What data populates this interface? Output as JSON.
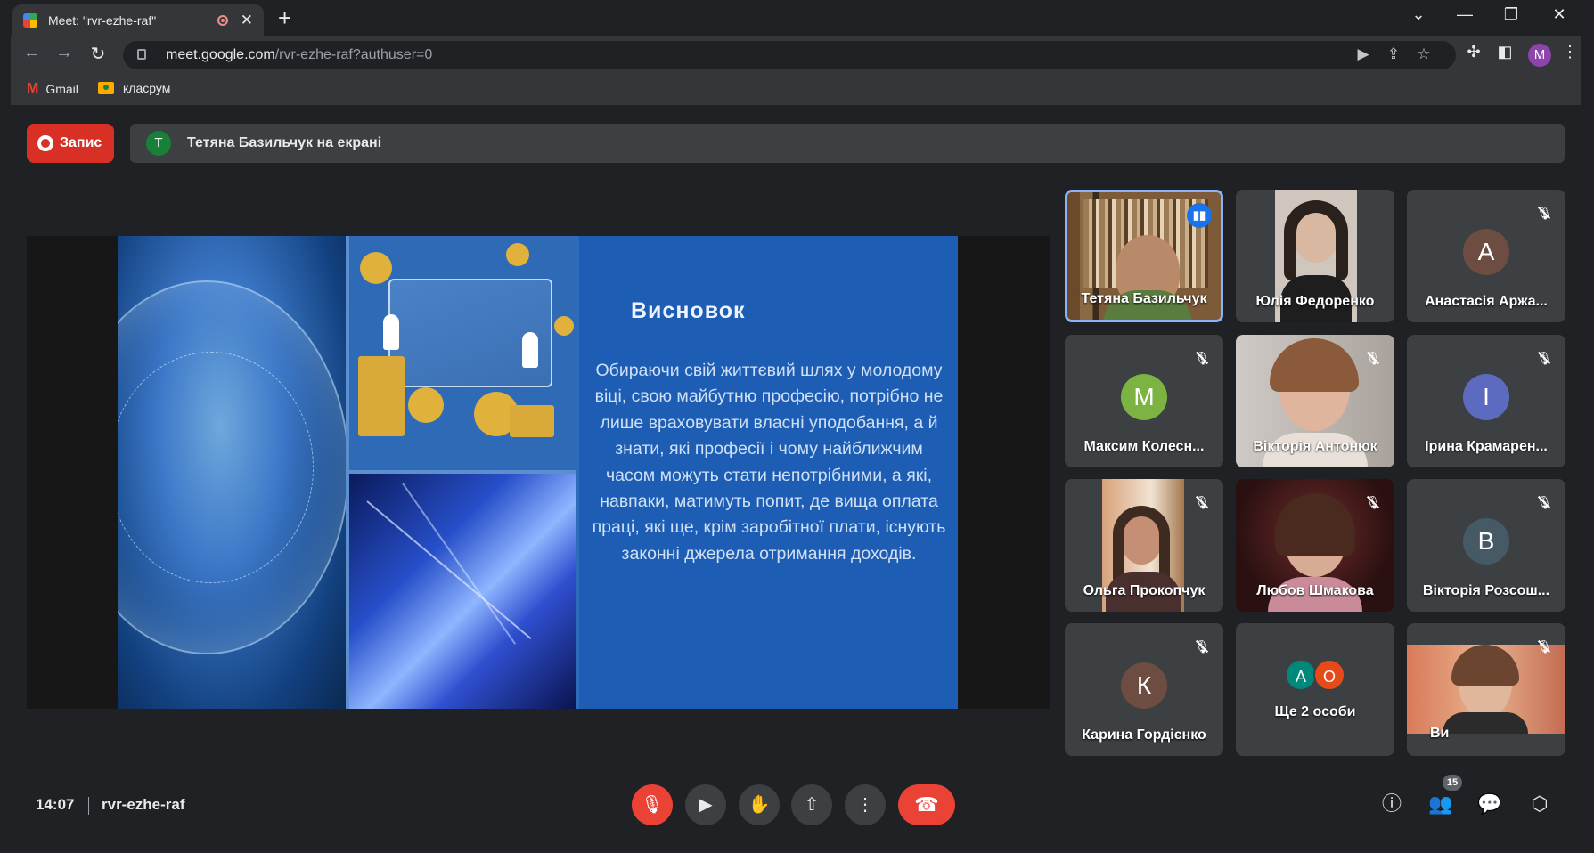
{
  "browser": {
    "tab_title": "Meet: \"rvr-ezhe-raf\"",
    "new_tab": "+",
    "url_host": "meet.google.com",
    "url_path": "/rvr-ezhe-raf?authuser=0",
    "profile_initial": "M",
    "bookmarks": [
      {
        "label": "Gmail"
      },
      {
        "label": "класрум"
      }
    ]
  },
  "meet": {
    "record_label": "Запис",
    "presenter_initial": "T",
    "presenter_banner": "Тетяна Базильчук на екрані",
    "slide": {
      "title": "Висновок",
      "body": "Обираючи свій життєвий шлях у молодому віці, свою майбутню професію, потрібно не лише враховувати власні уподобання, а й знати, які професії і чому найближчим часом можуть стати непотрібними, а які, навпаки, матимуть попит, де вища оплата праці, які ще, крім заробітної плати, існують законні джерела отримання доходів."
    },
    "participants": [
      {
        "name": "Тетяна Базильчук",
        "initial": "",
        "color": "",
        "speaking": true
      },
      {
        "name": "Юлія Федоренко",
        "initial": "",
        "color": ""
      },
      {
        "name": "Анастасія Аржа...",
        "initial": "А",
        "color": "#6d4c41"
      },
      {
        "name": "Максим Колесн...",
        "initial": "М",
        "color": "#7cb342"
      },
      {
        "name": "Вікторія Антонюк",
        "initial": "",
        "color": ""
      },
      {
        "name": "Ірина Крамарен...",
        "initial": "І",
        "color": "#5c6bc0"
      },
      {
        "name": "Ольга Прокопчук",
        "initial": "",
        "color": ""
      },
      {
        "name": "Любов Шмакова",
        "initial": "",
        "color": ""
      },
      {
        "name": "Вікторія Розсош...",
        "initial": "В",
        "color": "#455a64"
      },
      {
        "name": "Карина Гордієнко",
        "initial": "К",
        "color": "#6d4c41"
      },
      {
        "name": "Ще 2 особи",
        "initial": "",
        "color": "",
        "extra_initials": [
          "А",
          "О"
        ],
        "extra_colors": [
          "#00897b",
          "#e64a19"
        ]
      },
      {
        "name": "Ви",
        "initial": "",
        "color": ""
      }
    ],
    "time": "14:07",
    "meeting_code": "rvr-ezhe-raf",
    "people_count": "15"
  }
}
